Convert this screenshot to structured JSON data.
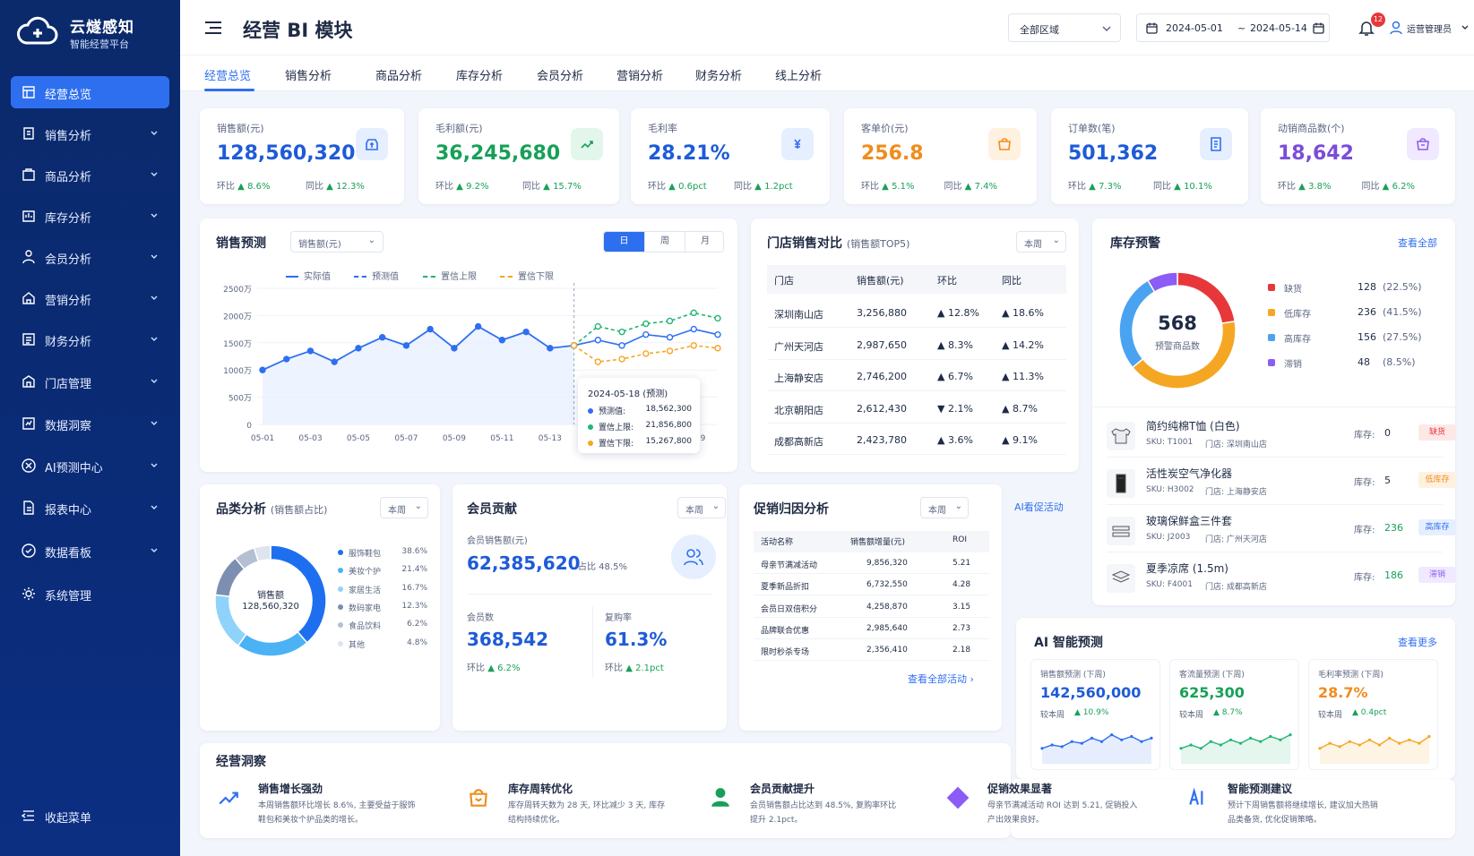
{
  "brand": {
    "name": "云燧感知",
    "tagline": "智能经营平台"
  },
  "nav": [
    {
      "label": "经营总览",
      "icon": "dashboard-icon",
      "active": true
    },
    {
      "label": "销售分析",
      "icon": "sales-icon"
    },
    {
      "label": "商品分析",
      "icon": "product-icon"
    },
    {
      "label": "库存分析",
      "icon": "inventory-icon"
    },
    {
      "label": "会员分析",
      "icon": "member-icon"
    },
    {
      "label": "营销分析",
      "icon": "marketing-icon"
    },
    {
      "label": "财务分析",
      "icon": "finance-icon"
    },
    {
      "label": "门店管理",
      "icon": "store-icon"
    },
    {
      "label": "数据洞察",
      "icon": "insight-icon"
    },
    {
      "label": "AI预测中心",
      "icon": "ai-icon"
    },
    {
      "label": "报表中心",
      "icon": "report-icon"
    },
    {
      "label": "数据看板",
      "icon": "board-icon"
    },
    {
      "label": "系统管理",
      "icon": "settings-icon"
    }
  ],
  "collapse_label": "收起菜单",
  "header": {
    "title": "经营 BI 模块",
    "region": "全部区域",
    "date_start": "2024-05-01",
    "date_sep": "~",
    "date_end": "2024-05-14",
    "badge": "12",
    "user": "运营管理员"
  },
  "tabs": [
    "经营总览",
    "销售分析",
    "商品分析",
    "库存分析",
    "会员分析",
    "营销分析",
    "财务分析",
    "线上分析"
  ],
  "kpis": [
    {
      "label": "销售额(元)",
      "value": "128,560,320",
      "hb": "8.6%",
      "tb": "12.3%",
      "color": "#1e5bd8",
      "icon_bg": "#e6efff",
      "icon_fg": "#2e6ff0",
      "icon": "money-bag-icon"
    },
    {
      "label": "毛利额(元)",
      "value": "36,245,680",
      "hb": "9.2%",
      "tb": "15.7%",
      "color": "#18a058",
      "icon_bg": "#e3f6ec",
      "icon_fg": "#18a058",
      "icon": "profit-icon"
    },
    {
      "label": "毛利率",
      "value": "28.21%",
      "hb": "0.6pct",
      "tb": "1.2pct",
      "color": "#1e5bd8",
      "icon_bg": "#e6efff",
      "icon_fg": "#2e6ff0",
      "icon": "yen-icon"
    },
    {
      "label": "客单价(元)",
      "value": "256.8",
      "hb": "5.1%",
      "tb": "7.4%",
      "color": "#f08c1e",
      "icon_bg": "#fff1e0",
      "icon_fg": "#f08c1e",
      "icon": "shopping-bag-icon"
    },
    {
      "label": "订单数(笔)",
      "value": "501,362",
      "hb": "7.3%",
      "tb": "10.1%",
      "color": "#1e5bd8",
      "icon_bg": "#e6efff",
      "icon_fg": "#2e6ff0",
      "icon": "order-icon"
    },
    {
      "label": "动销商品数(个)",
      "value": "18,642",
      "hb": "3.8%",
      "tb": "6.2%",
      "color": "#7b4dd8",
      "icon_bg": "#f0e9ff",
      "icon_fg": "#8b5cf6",
      "icon": "goods-icon"
    }
  ],
  "kpi_hb_label": "环比",
  "kpi_tb_label": "同比",
  "forecast": {
    "title": "销售预测",
    "metric": "销售额(元)",
    "periods": [
      "日",
      "周",
      "月"
    ],
    "tooltip": {
      "title": "2024-05-18 (预测)",
      "rows": [
        {
          "label": "预测值:",
          "value": "18,562,300",
          "color": "#2e6ff0"
        },
        {
          "label": "置信上限:",
          "value": "21,856,800",
          "color": "#22b573"
        },
        {
          "label": "置信下限:",
          "value": "15,267,800",
          "color": "#f5a623"
        }
      ]
    }
  },
  "chart_data": {
    "type": "line",
    "title": "销售预测",
    "xlabel": "",
    "ylabel": "",
    "x": [
      "05-01",
      "05-02",
      "05-03",
      "05-04",
      "05-05",
      "05-06",
      "05-07",
      "05-08",
      "05-09",
      "05-10",
      "05-11",
      "05-12",
      "05-13",
      "05-14",
      "05-15",
      "05-16",
      "05-17",
      "05-18",
      "05-19",
      "05-20"
    ],
    "x_ticks": [
      "05-01",
      "05-03",
      "05-05",
      "05-07",
      "05-09",
      "05-11",
      "05-13",
      "05-15",
      "05-17",
      "05-19"
    ],
    "y_ticks": [
      "0",
      "500万",
      "1000万",
      "1500万",
      "2000万",
      "2500万"
    ],
    "ylim": [
      0,
      2500
    ],
    "series": [
      {
        "name": "实际值",
        "color": "#2e6ff0",
        "values": [
          1000,
          1200,
          1350,
          1150,
          1400,
          1600,
          1450,
          1750,
          1400,
          1800,
          1550,
          1700,
          1400,
          1450,
          null,
          null,
          null,
          null,
          null,
          null
        ]
      },
      {
        "name": "预测值",
        "color": "#2e6ff0",
        "dashed": true,
        "values": [
          null,
          null,
          null,
          null,
          null,
          null,
          null,
          null,
          null,
          null,
          null,
          null,
          null,
          1450,
          1550,
          1450,
          1650,
          1600,
          1750,
          1650
        ]
      },
      {
        "name": "置信上限",
        "color": "#22b573",
        "dashed": true,
        "values": [
          null,
          null,
          null,
          null,
          null,
          null,
          null,
          null,
          null,
          null,
          null,
          null,
          null,
          1450,
          1800,
          1700,
          1850,
          1900,
          2050,
          1950
        ]
      },
      {
        "name": "置信下限",
        "color": "#f5a623",
        "dashed": true,
        "values": [
          null,
          null,
          null,
          null,
          null,
          null,
          null,
          null,
          null,
          null,
          null,
          null,
          null,
          1450,
          1150,
          1200,
          1300,
          1350,
          1450,
          1400
        ]
      }
    ]
  },
  "store": {
    "title": "门店销售对比",
    "sub": "(销售额TOP5)",
    "period": "本周",
    "headers": [
      "门店",
      "销售额(元)",
      "环比",
      "同比"
    ],
    "rows": [
      {
        "name": "深圳南山店",
        "sales": "3,256,880",
        "hb": "▲ 12.8%",
        "tb": "▲ 18.6%"
      },
      {
        "name": "广州天河店",
        "sales": "2,987,650",
        "hb": "▲ 8.3%",
        "tb": "▲ 14.2%"
      },
      {
        "name": "上海静安店",
        "sales": "2,746,200",
        "hb": "▲ 6.7%",
        "tb": "▲ 11.3%"
      },
      {
        "name": "北京朝阳店",
        "sales": "2,612,430",
        "hb": "▼ 2.1%",
        "tb": "▲ 8.7%"
      },
      {
        "name": "成都高新店",
        "sales": "2,423,780",
        "hb": "▲ 3.6%",
        "tb": "▲ 9.1%"
      }
    ]
  },
  "inventory": {
    "title": "库存预警",
    "link": "查看全部",
    "center_value": "568",
    "center_label": "预警商品数",
    "legend": [
      {
        "label": "缺货",
        "count": "128",
        "pct": "(22.5%)",
        "color": "#e8373a",
        "share": 22.5
      },
      {
        "label": "低库存",
        "count": "236",
        "pct": "(41.5%)",
        "color": "#f5a623",
        "share": 41.5
      },
      {
        "label": "高库存",
        "count": "156",
        "pct": "(27.5%)",
        "color": "#4aa3f0",
        "share": 27.5
      },
      {
        "label": "滞销",
        "count": "48",
        "pct": "(8.5%)",
        "color": "#8b5cf6",
        "share": 8.5
      }
    ],
    "items": [
      {
        "name": "简约纯棉T恤 (白色)",
        "sku": "SKU: T1001",
        "store": "门店: 深圳南山店",
        "stock_label": "库存:",
        "stock": "0",
        "tag": "缺货",
        "tag_bg": "#fde8e8",
        "tag_fg": "#e8373a",
        "icon": "tshirt-icon"
      },
      {
        "name": "活性炭空气净化器",
        "sku": "SKU: H3002",
        "store": "门店: 上海静安店",
        "stock_label": "库存:",
        "stock": "5",
        "tag": "低库存",
        "tag_bg": "#fff1e0",
        "tag_fg": "#f08c1e",
        "icon": "purifier-icon"
      },
      {
        "name": "玻璃保鲜盒三件套",
        "sku": "SKU: J2003",
        "store": "门店: 广州天河店",
        "stock_label": "库存:",
        "stock": "236",
        "tag": "高库存",
        "tag_bg": "#e6efff",
        "tag_fg": "#2e6ff0",
        "icon": "container-icon"
      },
      {
        "name": "夏季凉席 (1.5m)",
        "sku": "SKU: F4001",
        "store": "门店: 成都高新店",
        "stock_label": "库存:",
        "stock": "186",
        "tag": "滞销",
        "tag_bg": "#f0e9ff",
        "tag_fg": "#8b5cf6",
        "icon": "mat-icon"
      }
    ]
  },
  "category": {
    "title": "品类分析",
    "sub": "(销售额占比)",
    "period": "本周",
    "center_label": "销售额",
    "center_value": "128,560,320",
    "items": [
      {
        "label": "服饰鞋包",
        "pct": "38.6%",
        "share": 38.6,
        "color": "#1e6ff0"
      },
      {
        "label": "美妆个护",
        "pct": "21.4%",
        "share": 21.4,
        "color": "#4ab2f5"
      },
      {
        "label": "家居生活",
        "pct": "16.7%",
        "share": 16.7,
        "color": "#8fd3fb"
      },
      {
        "label": "数码家电",
        "pct": "12.3%",
        "share": 12.3,
        "color": "#7d8fb0"
      },
      {
        "label": "食品饮料",
        "pct": "6.2%",
        "share": 6.2,
        "color": "#b4bfd3"
      },
      {
        "label": "其他",
        "pct": "4.8%",
        "share": 4.8,
        "color": "#dfe4ee"
      }
    ]
  },
  "member": {
    "title": "会员贡献",
    "period": "本周",
    "sales_label": "会员销售额(元)",
    "sales_value": "62,385,620",
    "share_label": "占比 48.5%",
    "count_label": "会员数",
    "count_value": "368,542",
    "count_hb": "6.2%",
    "repurchase_label": "复购率",
    "repurchase_value": "61.3%",
    "repurchase_hb": "2.1pct",
    "hb_label": "环比"
  },
  "promo": {
    "title": "促销归因分析",
    "period": "本周",
    "ai_link": "AI看促活动",
    "headers": [
      "活动名称",
      "销售额增量(元)",
      "ROI"
    ],
    "rows": [
      {
        "name": "母亲节满减活动",
        "inc": "9,856,320",
        "roi": "5.21"
      },
      {
        "name": "夏季新品折扣",
        "inc": "6,732,550",
        "roi": "4.28"
      },
      {
        "name": "会员日双倍积分",
        "inc": "4,258,870",
        "roi": "3.15"
      },
      {
        "name": "品牌联合优惠",
        "inc": "2,985,640",
        "roi": "2.73"
      },
      {
        "name": "限时秒杀专场",
        "inc": "2,356,410",
        "roi": "2.18"
      }
    ],
    "more": "查看全部活动"
  },
  "ai": {
    "title": "AI 智能预测",
    "link": "查看更多",
    "cards": [
      {
        "label": "销售额预测 (下周)",
        "value": "142,560,000",
        "cmp": "较本周",
        "chg": "▲ 10.9%",
        "color": "#1e5bd8",
        "spark": [
          4,
          5,
          4.5,
          6,
          5.5,
          7,
          6,
          8,
          6.5,
          7.5,
          6,
          7
        ],
        "spark_color": "#2e6ff0"
      },
      {
        "label": "客流量预测 (下周)",
        "value": "625,300",
        "cmp": "较本周",
        "chg": "▲ 8.7%",
        "color": "#18a058",
        "spark": [
          4,
          5,
          4,
          6,
          5,
          6.5,
          5.5,
          7,
          6,
          7.5,
          6.5,
          8
        ],
        "spark_color": "#22b573"
      },
      {
        "label": "毛利率预测 (下周)",
        "value": "28.7%",
        "cmp": "较本周",
        "chg": "▲ 0.4pct",
        "color": "#f08c1e",
        "spark": [
          4,
          5.5,
          4.5,
          6,
          5,
          6.5,
          5,
          7,
          5.5,
          6.5,
          5.5,
          7.5
        ],
        "spark_color": "#f5a623"
      }
    ]
  },
  "insight": {
    "title": "经营洞察",
    "items": [
      {
        "title": "销售增长强劲",
        "text1": "本周销售额环比增长 8.6%, 主要受益于服饰",
        "text2": "鞋包和美妆个护品类的增长。",
        "icon": "trend-up-icon",
        "color": "#2e6ff0"
      },
      {
        "title": "库存周转优化",
        "text1": "库存周转天数为 28 天, 环比减少 3 天, 库存",
        "text2": "结构持续优化。",
        "icon": "box-icon",
        "color": "#f08c1e"
      },
      {
        "title": "会员贡献提升",
        "text1": "会员销售额占比达到 48.5%, 复购率环比",
        "text2": "提升 2.1pct。",
        "icon": "user-icon",
        "color": "#18a058"
      },
      {
        "title": "促销效果显著",
        "text1": "母亲节满减活动 ROI 达到 5.21, 促销投入",
        "text2": "产出效果良好。",
        "icon": "tag-icon",
        "color": "#8b5cf6"
      },
      {
        "title": "智能预测建议",
        "text1": "预计下周销售额将继续增长, 建议加大热销",
        "text2": "品类备货, 优化促销策略。",
        "icon": "ai-badge-icon",
        "color": "#2e6ff0"
      }
    ]
  }
}
